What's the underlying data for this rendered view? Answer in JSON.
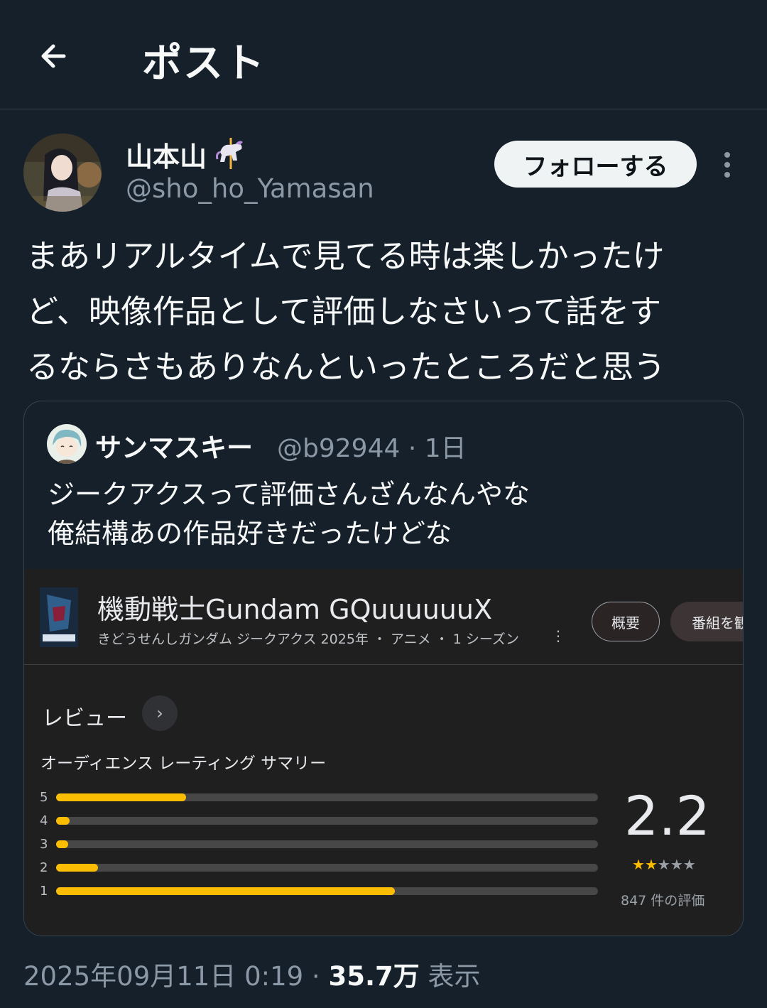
{
  "header": {
    "title": "ポスト",
    "back_icon": "arrow-left-icon"
  },
  "post": {
    "author_name": "山本山",
    "author_emoji": "carousel-horse-icon",
    "author_handle": "@sho_ho_Yamasan",
    "follow_label": "フォローする",
    "more_icon": "more-vertical-icon",
    "text_lines": [
      "まあリアルタイムで見てる時は楽しかったけ",
      "ど、映像作品として評価しなさいって話をす",
      "るならさもありなんといったところだと思う"
    ]
  },
  "quote": {
    "author_name": "サンマスキー",
    "meta": "@b92944 · 1日",
    "text_lines": [
      "ジークアクスって評価さんざんなんやな",
      "俺結構あの作品好きだったけどな"
    ]
  },
  "screenshot": {
    "show_title": "機動戦士Gundam GQuuuuuuX",
    "show_subtitle": "きどうせんしガンダム ジークアクス  2025年 ・ アニメ ・ 1 シーズン",
    "more_icon": "⋮",
    "chip_overview": "概要",
    "chip_watch": "番組を観",
    "reviews_title": "レビュー",
    "reviews_arrow": "›",
    "summary_title": "オーディエンス レーティング サマリー",
    "score": "2.2",
    "rating_count": "847 件の評価",
    "stars_filled": 2,
    "stars_total": 5
  },
  "chart_data": {
    "type": "bar",
    "orientation": "horizontal",
    "categories": [
      "5",
      "4",
      "3",
      "2",
      "1"
    ],
    "values": [
      0.24,
      0.025,
      0.022,
      0.077,
      0.625
    ],
    "value_unit": "fraction of ratings"
  },
  "footer": {
    "timestamp": "2025年09月11日 0:19 · ",
    "views": "35.7万",
    "views_label": " 表示"
  },
  "colors": {
    "background": "#15202b",
    "bar_fill": "#fbbc04",
    "bar_track": "#474747"
  }
}
